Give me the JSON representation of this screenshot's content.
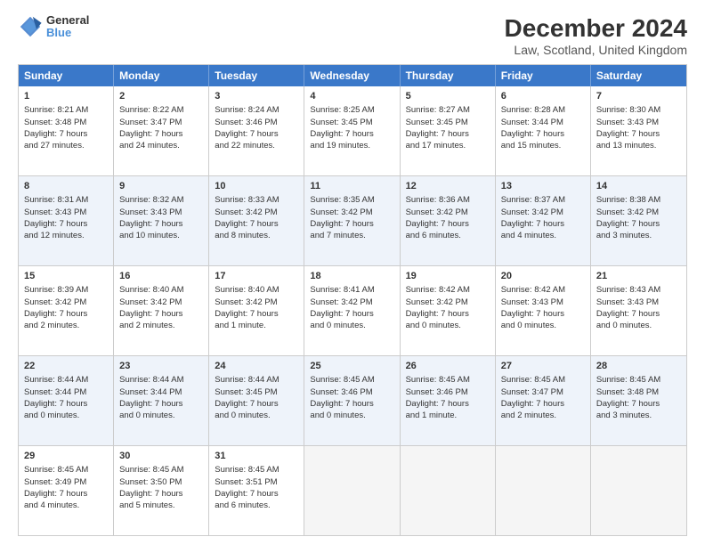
{
  "logo": {
    "line1": "General",
    "line2": "Blue"
  },
  "title": "December 2024",
  "subtitle": "Law, Scotland, United Kingdom",
  "header_days": [
    "Sunday",
    "Monday",
    "Tuesday",
    "Wednesday",
    "Thursday",
    "Friday",
    "Saturday"
  ],
  "rows": [
    [
      {
        "day": "1",
        "lines": [
          "Sunrise: 8:21 AM",
          "Sunset: 3:48 PM",
          "Daylight: 7 hours",
          "and 27 minutes."
        ]
      },
      {
        "day": "2",
        "lines": [
          "Sunrise: 8:22 AM",
          "Sunset: 3:47 PM",
          "Daylight: 7 hours",
          "and 24 minutes."
        ]
      },
      {
        "day": "3",
        "lines": [
          "Sunrise: 8:24 AM",
          "Sunset: 3:46 PM",
          "Daylight: 7 hours",
          "and 22 minutes."
        ]
      },
      {
        "day": "4",
        "lines": [
          "Sunrise: 8:25 AM",
          "Sunset: 3:45 PM",
          "Daylight: 7 hours",
          "and 19 minutes."
        ]
      },
      {
        "day": "5",
        "lines": [
          "Sunrise: 8:27 AM",
          "Sunset: 3:45 PM",
          "Daylight: 7 hours",
          "and 17 minutes."
        ]
      },
      {
        "day": "6",
        "lines": [
          "Sunrise: 8:28 AM",
          "Sunset: 3:44 PM",
          "Daylight: 7 hours",
          "and 15 minutes."
        ]
      },
      {
        "day": "7",
        "lines": [
          "Sunrise: 8:30 AM",
          "Sunset: 3:43 PM",
          "Daylight: 7 hours",
          "and 13 minutes."
        ]
      }
    ],
    [
      {
        "day": "8",
        "lines": [
          "Sunrise: 8:31 AM",
          "Sunset: 3:43 PM",
          "Daylight: 7 hours",
          "and 12 minutes."
        ]
      },
      {
        "day": "9",
        "lines": [
          "Sunrise: 8:32 AM",
          "Sunset: 3:43 PM",
          "Daylight: 7 hours",
          "and 10 minutes."
        ]
      },
      {
        "day": "10",
        "lines": [
          "Sunrise: 8:33 AM",
          "Sunset: 3:42 PM",
          "Daylight: 7 hours",
          "and 8 minutes."
        ]
      },
      {
        "day": "11",
        "lines": [
          "Sunrise: 8:35 AM",
          "Sunset: 3:42 PM",
          "Daylight: 7 hours",
          "and 7 minutes."
        ]
      },
      {
        "day": "12",
        "lines": [
          "Sunrise: 8:36 AM",
          "Sunset: 3:42 PM",
          "Daylight: 7 hours",
          "and 6 minutes."
        ]
      },
      {
        "day": "13",
        "lines": [
          "Sunrise: 8:37 AM",
          "Sunset: 3:42 PM",
          "Daylight: 7 hours",
          "and 4 minutes."
        ]
      },
      {
        "day": "14",
        "lines": [
          "Sunrise: 8:38 AM",
          "Sunset: 3:42 PM",
          "Daylight: 7 hours",
          "and 3 minutes."
        ]
      }
    ],
    [
      {
        "day": "15",
        "lines": [
          "Sunrise: 8:39 AM",
          "Sunset: 3:42 PM",
          "Daylight: 7 hours",
          "and 2 minutes."
        ]
      },
      {
        "day": "16",
        "lines": [
          "Sunrise: 8:40 AM",
          "Sunset: 3:42 PM",
          "Daylight: 7 hours",
          "and 2 minutes."
        ]
      },
      {
        "day": "17",
        "lines": [
          "Sunrise: 8:40 AM",
          "Sunset: 3:42 PM",
          "Daylight: 7 hours",
          "and 1 minute."
        ]
      },
      {
        "day": "18",
        "lines": [
          "Sunrise: 8:41 AM",
          "Sunset: 3:42 PM",
          "Daylight: 7 hours",
          "and 0 minutes."
        ]
      },
      {
        "day": "19",
        "lines": [
          "Sunrise: 8:42 AM",
          "Sunset: 3:42 PM",
          "Daylight: 7 hours",
          "and 0 minutes."
        ]
      },
      {
        "day": "20",
        "lines": [
          "Sunrise: 8:42 AM",
          "Sunset: 3:43 PM",
          "Daylight: 7 hours",
          "and 0 minutes."
        ]
      },
      {
        "day": "21",
        "lines": [
          "Sunrise: 8:43 AM",
          "Sunset: 3:43 PM",
          "Daylight: 7 hours",
          "and 0 minutes."
        ]
      }
    ],
    [
      {
        "day": "22",
        "lines": [
          "Sunrise: 8:44 AM",
          "Sunset: 3:44 PM",
          "Daylight: 7 hours",
          "and 0 minutes."
        ]
      },
      {
        "day": "23",
        "lines": [
          "Sunrise: 8:44 AM",
          "Sunset: 3:44 PM",
          "Daylight: 7 hours",
          "and 0 minutes."
        ]
      },
      {
        "day": "24",
        "lines": [
          "Sunrise: 8:44 AM",
          "Sunset: 3:45 PM",
          "Daylight: 7 hours",
          "and 0 minutes."
        ]
      },
      {
        "day": "25",
        "lines": [
          "Sunrise: 8:45 AM",
          "Sunset: 3:46 PM",
          "Daylight: 7 hours",
          "and 0 minutes."
        ]
      },
      {
        "day": "26",
        "lines": [
          "Sunrise: 8:45 AM",
          "Sunset: 3:46 PM",
          "Daylight: 7 hours",
          "and 1 minute."
        ]
      },
      {
        "day": "27",
        "lines": [
          "Sunrise: 8:45 AM",
          "Sunset: 3:47 PM",
          "Daylight: 7 hours",
          "and 2 minutes."
        ]
      },
      {
        "day": "28",
        "lines": [
          "Sunrise: 8:45 AM",
          "Sunset: 3:48 PM",
          "Daylight: 7 hours",
          "and 3 minutes."
        ]
      }
    ],
    [
      {
        "day": "29",
        "lines": [
          "Sunrise: 8:45 AM",
          "Sunset: 3:49 PM",
          "Daylight: 7 hours",
          "and 4 minutes."
        ]
      },
      {
        "day": "30",
        "lines": [
          "Sunrise: 8:45 AM",
          "Sunset: 3:50 PM",
          "Daylight: 7 hours",
          "and 5 minutes."
        ]
      },
      {
        "day": "31",
        "lines": [
          "Sunrise: 8:45 AM",
          "Sunset: 3:51 PM",
          "Daylight: 7 hours",
          "and 6 minutes."
        ]
      },
      {
        "day": "",
        "lines": []
      },
      {
        "day": "",
        "lines": []
      },
      {
        "day": "",
        "lines": []
      },
      {
        "day": "",
        "lines": []
      }
    ]
  ]
}
